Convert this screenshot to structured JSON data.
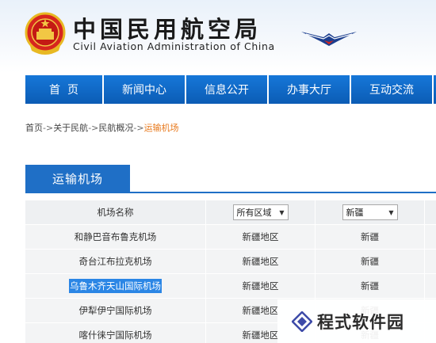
{
  "header": {
    "org_name_cn": "中国民用航空局",
    "org_name_en": "Civil Aviation Administration of China",
    "emblem_icon": "national-emblem-icon",
    "caac_logo_icon": "caac-wings-logo-icon"
  },
  "nav": {
    "items": [
      {
        "label": "首  页"
      },
      {
        "label": "新闻中心"
      },
      {
        "label": "信息公开"
      },
      {
        "label": "办事大厅"
      },
      {
        "label": "互动交流"
      }
    ]
  },
  "breadcrumb": {
    "items": [
      "首页",
      "关于民航",
      "民航概况"
    ],
    "separator": "->",
    "current": "运输机场"
  },
  "section": {
    "title": "运输机场"
  },
  "table": {
    "columns": {
      "name_header": "机场名称",
      "region_select": "所有区域",
      "province_select": "新疆"
    },
    "rows": [
      {
        "name": "和静巴音布鲁克机场",
        "region": "新疆地区",
        "province": "新疆",
        "selected": false
      },
      {
        "name": "奇台江布拉克机场",
        "region": "新疆地区",
        "province": "新疆",
        "selected": false
      },
      {
        "name": "乌鲁木齐天山国际机场",
        "region": "新疆地区",
        "province": "新疆",
        "selected": true
      },
      {
        "name": "伊犁伊宁国际机场",
        "region": "新疆地区",
        "province": "新疆",
        "selected": false
      },
      {
        "name": "喀什徕宁国际机场",
        "region": "新疆地区",
        "province": "新疆",
        "selected": false
      }
    ]
  },
  "watermark": {
    "text": "程式软件园",
    "icon": "diamond-logo-icon"
  },
  "colors": {
    "nav_blue": "#0b5cb5",
    "section_blue": "#1f6fc6",
    "breadcrumb_current": "#e87a1e",
    "selection_blue": "#2b86e5"
  }
}
